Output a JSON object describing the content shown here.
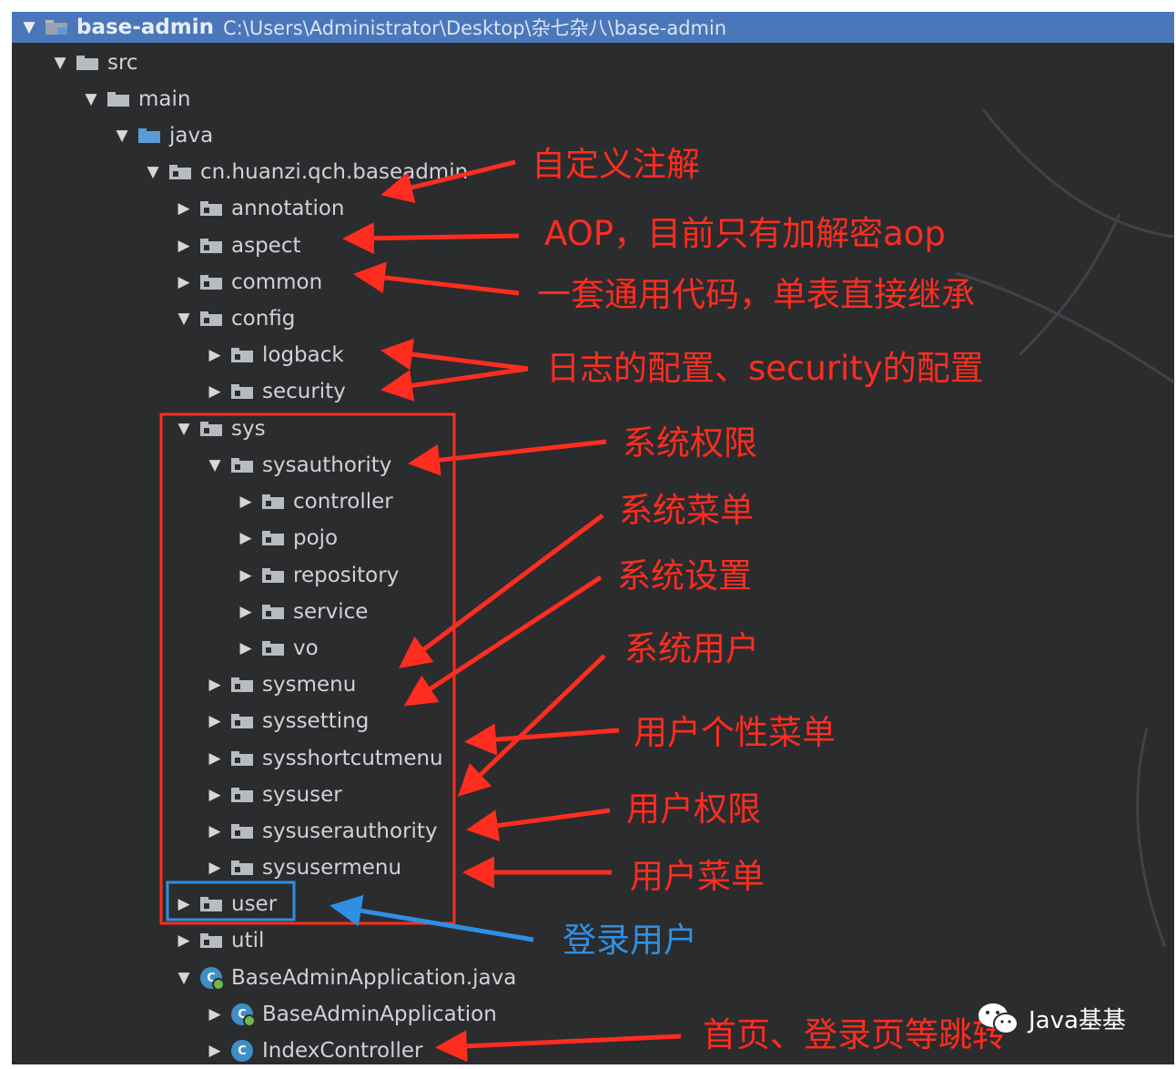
{
  "header": {
    "project_name": "base-admin",
    "project_path": "C:\\Users\\Administrator\\Desktop\\杂七杂八\\base-admin"
  },
  "tree": {
    "src": "src",
    "main": "main",
    "java": "java",
    "package": "cn.huanzi.qch.baseadmin",
    "annotation": "annotation",
    "aspect": "aspect",
    "common": "common",
    "config": "config",
    "logback": "logback",
    "security": "security",
    "sys": "sys",
    "sysauthority": "sysauthority",
    "controller": "controller",
    "pojo": "pojo",
    "repository": "repository",
    "service": "service",
    "vo": "vo",
    "sysmenu": "sysmenu",
    "syssetting": "syssetting",
    "sysshortcutmenu": "sysshortcutmenu",
    "sysuser": "sysuser",
    "sysuserauthority": "sysuserauthority",
    "sysusermenu": "sysusermenu",
    "user": "user",
    "util": "util",
    "app_file": "BaseAdminApplication.java",
    "app_class": "BaseAdminApplication",
    "index_controller": "IndexController"
  },
  "annotations": {
    "custom_annotation": "自定义注解",
    "aop": "AOP，目前只有加解密aop",
    "common_code": "一套通用代码，单表直接继承",
    "config": "日志的配置、security的配置",
    "sys_authority": "系统权限",
    "sys_menu": "系统菜单",
    "sys_setting": "系统设置",
    "sys_user": "系统用户",
    "user_shortcut_menu": "用户个性菜单",
    "user_authority": "用户权限",
    "user_menu": "用户菜单",
    "login_user": "登录用户",
    "index_redirect": "首页、登录页等跳转"
  },
  "watermark": {
    "text": "Java基基",
    "icon": "wechat-icon"
  },
  "colors": {
    "header": "#4a77ba",
    "panel": "#2b2c2e",
    "annotation_red": "#ff2d20",
    "annotation_blue": "#2f8fe3"
  }
}
